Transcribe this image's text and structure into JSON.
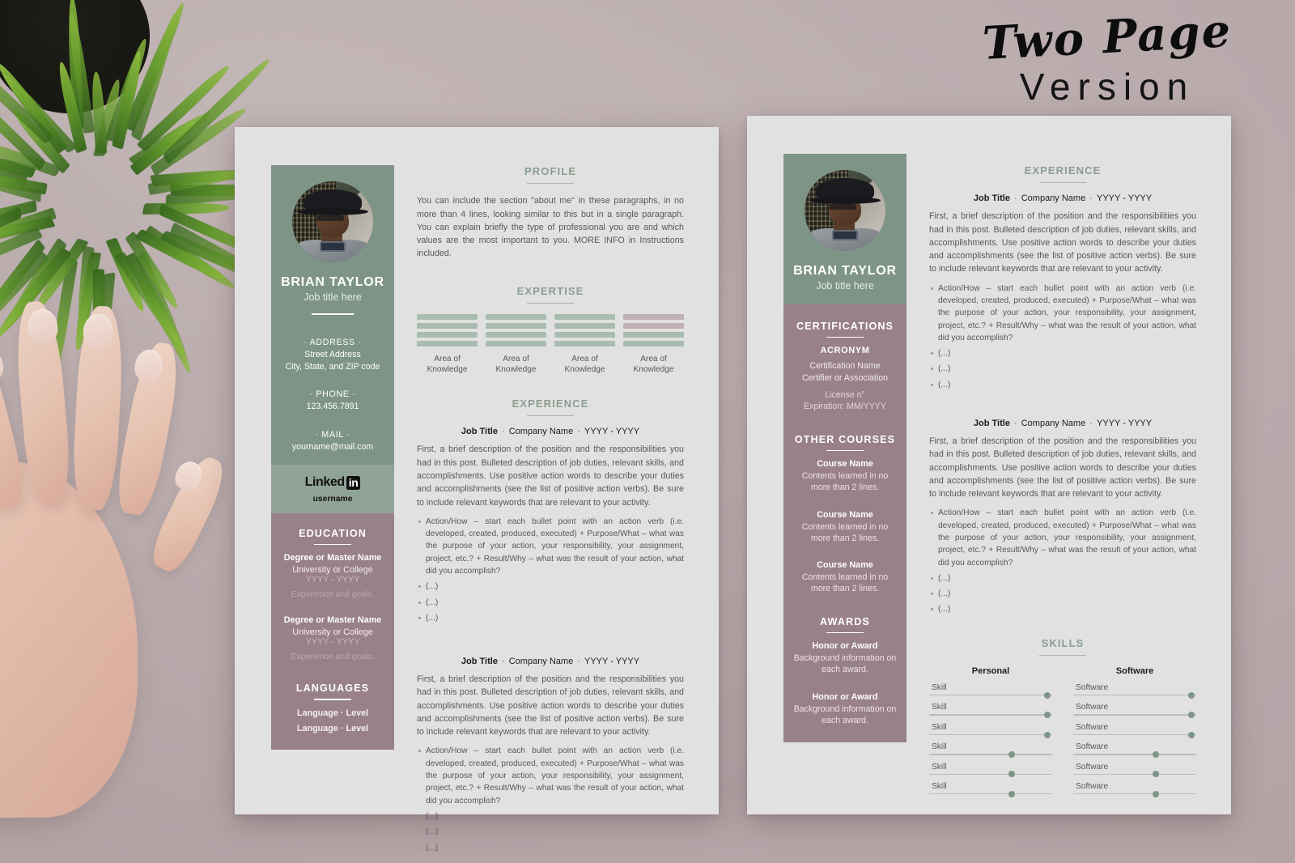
{
  "headline": {
    "script": "Two Page",
    "sub": "Version"
  },
  "colors": {
    "background": "#c0b2b3",
    "paper": "#e1e1e1",
    "green": "#7e9487",
    "green_light": "#90a397",
    "mauve": "#998189",
    "heading_green": "#8a9d90",
    "body_text": "#58585a"
  },
  "person": {
    "name": "BRIAN TAYLOR",
    "role": "Job title here"
  },
  "page1": {
    "sidebar": {
      "address_label": "· ADDRESS ·",
      "address_line1": "Street Address",
      "address_line2": "City, State, and ZIP code",
      "phone_label": "· PHONE ·",
      "phone_value": "123.456.7891",
      "mail_label": "· MAIL ·",
      "mail_value": "yourname@mail.com",
      "linkedin_logo": "Linked",
      "linkedin_badge": "in",
      "linkedin_user": "username",
      "education_title": "EDUCATION",
      "education": [
        {
          "degree": "Degree or Master Name",
          "school": "University or College",
          "years": "YYYY - YYYY",
          "note": "Experience and goals."
        },
        {
          "degree": "Degree or Master Name",
          "school": "University or College",
          "years": "YYYY - YYYY",
          "note": "Experience and goals."
        }
      ],
      "languages_title": "LANGUAGES",
      "languages": [
        "Language  ·  Level",
        "Language  ·  Level"
      ]
    },
    "main": {
      "profile_title": "PROFILE",
      "profile_text": "You can include the section \"about me\" in these paragraphs, in no more than 4 lines, looking similar to this but in a single paragraph. You can explain briefly the type of professional you are and which values are the most important to you. MORE INFO in Instructions included.",
      "expertise_title": "EXPERTISE",
      "expertise": [
        {
          "caption": "Area of\nKnowledge",
          "bars": [
            "green",
            "green",
            "green",
            "green"
          ]
        },
        {
          "caption": "Area of\nKnowledge",
          "bars": [
            "green",
            "green",
            "green",
            "green"
          ]
        },
        {
          "caption": "Area of\nKnowledge",
          "bars": [
            "green",
            "green",
            "green",
            "green"
          ]
        },
        {
          "caption": "Area of\nKnowledge",
          "bars": [
            "mauve",
            "mauve",
            "green",
            "green"
          ]
        }
      ],
      "experience_title": "EXPERIENCE",
      "jobs": [
        {
          "title": "Job Title",
          "company": "Company Name",
          "dates": "YYYY - YYYY",
          "body": "First, a brief description of the position and the responsibilities you had in this post. Bulleted description of job duties, relevant skills, and accomplishments. Use positive action words to describe your duties and accomplishments (see the list of positive action verbs). Be sure to include relevant keywords that are relevant to your activity.",
          "bullets": [
            "Action/How – start each bullet point with an action verb (i.e. developed, created, produced, executed) + Purpose/What – what was the purpose of your action, your responsibility, your assignment, project, etc.? + Result/Why – what was the result of your action, what did you accomplish?",
            "(...)",
            "(...)",
            "(...)"
          ]
        },
        {
          "title": "Job Title",
          "company": "Company Name",
          "dates": "YYYY - YYYY",
          "body": "First, a brief description of the position and the responsibilities you had in this post. Bulleted description of job duties, relevant skills, and accomplishments. Use positive action words to describe your duties and accomplishments (see the list of positive action verbs). Be sure to include relevant keywords that are relevant to your activity.",
          "bullets": [
            "Action/How – start each bullet point with an action verb (i.e. developed, created, produced, executed) + Purpose/What – what was the purpose of your action, your responsibility, your assignment, project, etc.? + Result/Why – what was the result of your action, what did you accomplish?",
            "(...)",
            "(...)",
            "(...)"
          ]
        }
      ]
    }
  },
  "page2": {
    "sidebar": {
      "certifications_title": "CERTIFICATIONS",
      "cert_acronym": "ACRONYM",
      "cert_name": "Certification Name",
      "cert_association": "Certifier or Association",
      "cert_license": "License n°",
      "cert_expiration": "Expiration: MM/YYYY",
      "courses_title": "OTHER COURSES",
      "courses": [
        {
          "name": "Course Name",
          "desc": "Contents learned in no more than 2 lines."
        },
        {
          "name": "Course Name",
          "desc": "Contents learned in no more than 2 lines."
        },
        {
          "name": "Course Name",
          "desc": "Contents learned in no more than 2 lines."
        }
      ],
      "awards_title": "AWARDS",
      "awards": [
        {
          "name": "Honor or Award",
          "desc": "Background information on each award."
        },
        {
          "name": "Honor or Award",
          "desc": "Background information on each award."
        }
      ]
    },
    "main": {
      "experience_title": "EXPERIENCE",
      "jobs": [
        {
          "title": "Job Title",
          "company": "Company Name",
          "dates": "YYYY - YYYY",
          "body": "First, a brief description of the position and the responsibilities you had in this post. Bulleted description of job duties, relevant skills, and accomplishments. Use positive action words to describe your duties and accomplishments (see the list of positive action verbs). Be sure to include relevant keywords that are relevant to your activity.",
          "bullets": [
            "Action/How – start each bullet point with an action verb (i.e. developed, created, produced, executed) + Purpose/What – what was the purpose of your action, your responsibility, your assignment, project, etc.? + Result/Why – what was the result of your action, what did you accomplish?",
            "(...)",
            "(...)",
            "(...)"
          ]
        },
        {
          "title": "Job Title",
          "company": "Company Name",
          "dates": "YYYY - YYYY",
          "body": "First, a brief description of the position and the responsibilities you had in this post. Bulleted description of job duties, relevant skills, and accomplishments. Use positive action words to describe your duties and accomplishments (see the list of positive action verbs). Be sure to include relevant keywords that are relevant to your activity.",
          "bullets": [
            "Action/How – start each bullet point with an action verb (i.e. developed, created, produced, executed) + Purpose/What – what was the purpose of your action, your responsibility, your assignment, project, etc.? + Result/Why – what was the result of your action, what did you accomplish?",
            "(...)",
            "(...)",
            "(...)"
          ]
        }
      ],
      "skills_title": "SKILLS",
      "skills": {
        "personal_header": "Personal",
        "software_header": "Software",
        "personal": [
          {
            "label": "Skill",
            "level": 96
          },
          {
            "label": "Skill",
            "level": 96
          },
          {
            "label": "Skill",
            "level": 96
          },
          {
            "label": "Skill",
            "level": 67
          },
          {
            "label": "Skill",
            "level": 67
          },
          {
            "label": "Skill",
            "level": 67
          }
        ],
        "software": [
          {
            "label": "Software",
            "level": 96
          },
          {
            "label": "Software",
            "level": 96
          },
          {
            "label": "Software",
            "level": 96
          },
          {
            "label": "Software",
            "level": 67
          },
          {
            "label": "Software",
            "level": 67
          },
          {
            "label": "Software",
            "level": 67
          }
        ]
      }
    }
  }
}
